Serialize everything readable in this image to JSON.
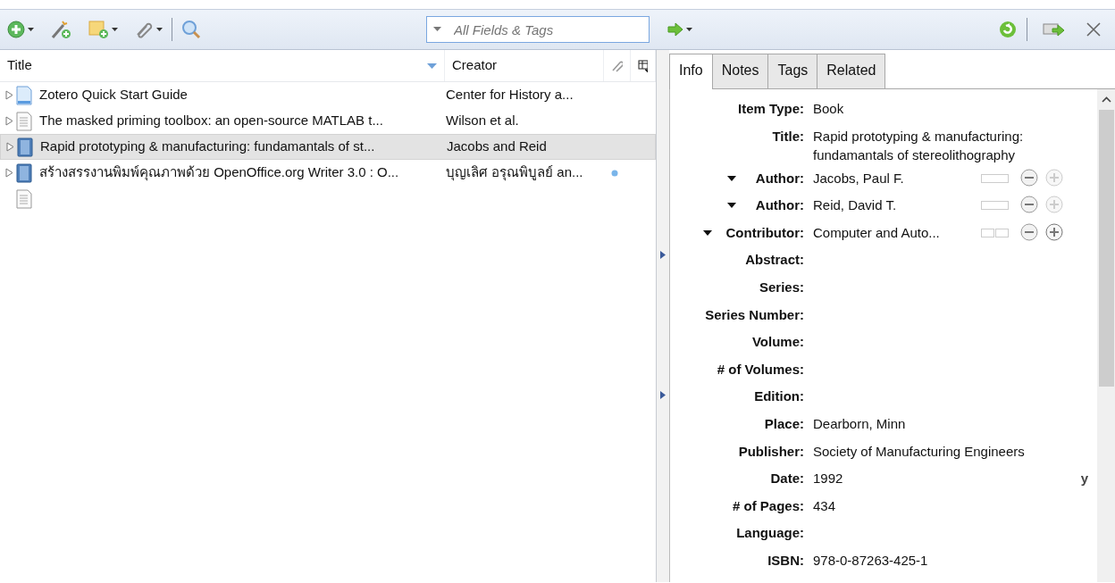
{
  "toolbar": {
    "search": {
      "placeholder": "All Fields & Tags"
    }
  },
  "item_list": {
    "columns": [
      {
        "label": "Title",
        "sorted": true
      },
      {
        "label": "Creator",
        "sorted": false
      }
    ],
    "rows": [
      {
        "kind": "guide",
        "title": "Zotero Quick Start Guide",
        "creator": "Center for History a...",
        "selected": false,
        "attachment_dot": false,
        "twisty": true
      },
      {
        "kind": "document",
        "title": "The masked priming toolbox: an open-source MATLAB t...",
        "creator": "Wilson et al.",
        "selected": false,
        "attachment_dot": false,
        "twisty": true
      },
      {
        "kind": "book",
        "title": "Rapid prototyping & manufacturing: fundamantals of st...",
        "creator": "Jacobs and Reid",
        "selected": true,
        "attachment_dot": false,
        "twisty": true
      },
      {
        "kind": "book",
        "title": "สร้างสรรงานพิมพ์คุณภาพด้วย OpenOffice.org Writer 3.0 : O...",
        "creator": "บุญเลิศ อรุณพิบูลย์ an...",
        "selected": false,
        "attachment_dot": true,
        "twisty": true
      },
      {
        "kind": "document",
        "selected": false,
        "attachment_dot": false,
        "twisty": false
      }
    ]
  },
  "item_pane": {
    "tabs": [
      {
        "label": "Info",
        "selected": true
      },
      {
        "label": "Notes",
        "selected": false
      },
      {
        "label": "Tags",
        "selected": false
      },
      {
        "label": "Related",
        "selected": false
      }
    ],
    "fields": [
      {
        "kind": "field",
        "label": "Item Type:",
        "value": "Book"
      },
      {
        "kind": "field",
        "label": "Title:",
        "value": "Rapid prototyping & manufacturing: fundamantals of stereolithography"
      },
      {
        "kind": "creator",
        "label": "Author:",
        "value": "Jacobs, Paul F.",
        "two_field": false,
        "plus_enabled": false
      },
      {
        "kind": "creator",
        "label": "Author:",
        "value": "Reid, David T.",
        "two_field": false,
        "plus_enabled": false
      },
      {
        "kind": "creator",
        "label": "Contributor:",
        "value": "Computer and Auto...",
        "two_field": true,
        "plus_enabled": true
      },
      {
        "kind": "field",
        "label": "Abstract:"
      },
      {
        "kind": "field",
        "label": "Series:"
      },
      {
        "kind": "field",
        "label": "Series Number:"
      },
      {
        "kind": "field",
        "label": "Volume:"
      },
      {
        "kind": "field",
        "label": "# of Volumes:"
      },
      {
        "kind": "field",
        "label": "Edition:"
      },
      {
        "kind": "field",
        "label": "Place:",
        "value": "Dearborn, Minn"
      },
      {
        "kind": "field",
        "label": "Publisher:",
        "value": "Society of Manufacturing Engineers"
      },
      {
        "kind": "field",
        "label": "Date:",
        "value": "1992",
        "date_parts": "y"
      },
      {
        "kind": "field",
        "label": "# of Pages:",
        "value": "434"
      },
      {
        "kind": "field",
        "label": "Language:"
      },
      {
        "kind": "field",
        "label": "ISBN:",
        "value": "978-0-87263-425-1"
      }
    ]
  }
}
